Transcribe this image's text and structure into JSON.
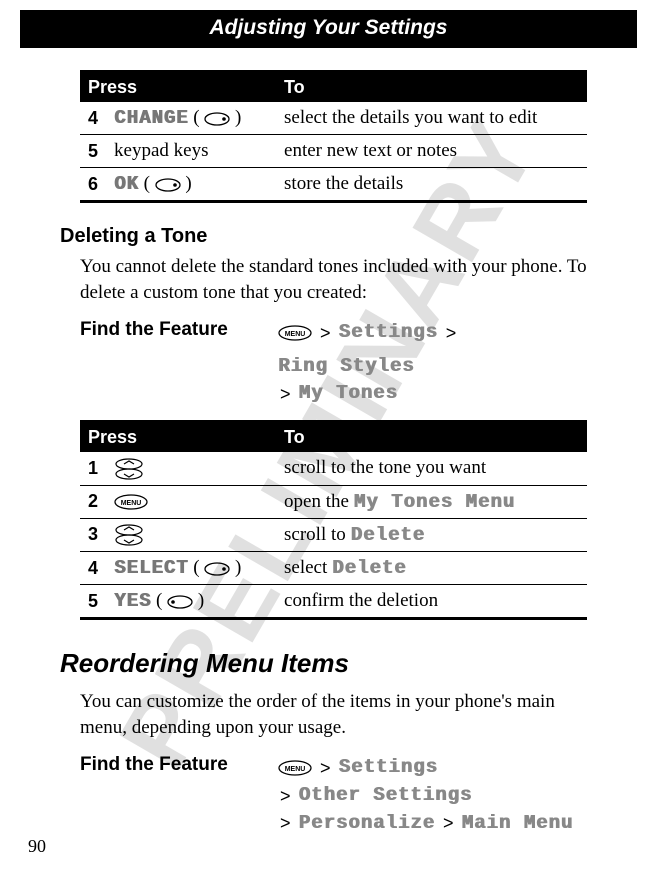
{
  "watermark": "PRELIMINARY",
  "page_title": "Adjusting Your Settings",
  "page_number": "90",
  "table1": {
    "head_press": "Press",
    "head_to": "To",
    "rows": [
      {
        "n": "4",
        "key": "CHANGE",
        "to": "select the details you want to edit"
      },
      {
        "n": "5",
        "plain": "keypad keys",
        "to": "enter new text or notes"
      },
      {
        "n": "6",
        "key": "OK",
        "to": "store the details"
      }
    ]
  },
  "delete_section": {
    "heading": "Deleting a Tone",
    "body": "You cannot delete the standard tones included with your phone. To delete a custom tone that you created:",
    "feature_label": "Find the Feature",
    "path": [
      "Settings",
      "Ring Styles",
      "My Tones"
    ]
  },
  "table2": {
    "head_press": "Press",
    "head_to": "To",
    "rows": [
      {
        "n": "1",
        "icon": "scroll",
        "to": "scroll to the tone you want"
      },
      {
        "n": "2",
        "icon": "menu",
        "to_prefix": "open the ",
        "to_menu": "My Tones Menu"
      },
      {
        "n": "3",
        "icon": "scroll",
        "to_prefix": "scroll to ",
        "to_menu": "Delete"
      },
      {
        "n": "4",
        "key": "SELECT",
        "keyicon": "right",
        "to_prefix": "select ",
        "to_menu": "Delete"
      },
      {
        "n": "5",
        "key": "YES",
        "keyicon": "left",
        "to": "confirm the deletion"
      }
    ]
  },
  "reorder_section": {
    "heading": "Reordering Menu Items",
    "body": "You can customize the order of the items in your phone's main menu, depending upon your usage.",
    "feature_label": "Find the Feature",
    "path": [
      "Settings",
      "Other Settings",
      "Personalize",
      "Main Menu"
    ]
  }
}
